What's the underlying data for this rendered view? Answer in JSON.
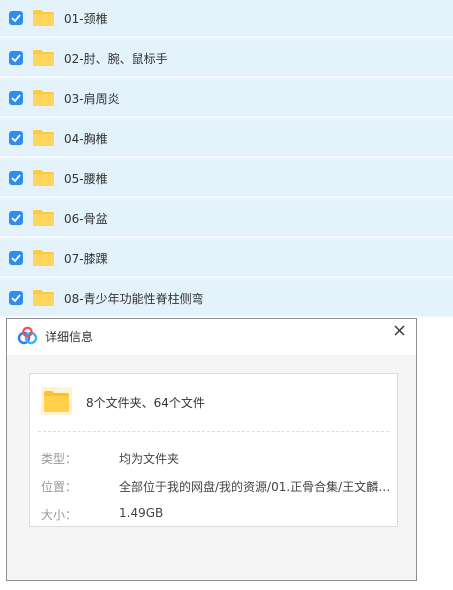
{
  "file_list": {
    "items": [
      {
        "label": "01-颈椎",
        "checked": true
      },
      {
        "label": "02-肘、腕、鼠标手",
        "checked": true
      },
      {
        "label": "03-肩周炎",
        "checked": true
      },
      {
        "label": "04-胸椎",
        "checked": true
      },
      {
        "label": "05-腰椎",
        "checked": true
      },
      {
        "label": "06-骨盆",
        "checked": true
      },
      {
        "label": "07-膝踝",
        "checked": true
      },
      {
        "label": "08-青少年功能性脊柱侧弯",
        "checked": true
      }
    ]
  },
  "dialog": {
    "title": "详细信息",
    "summary": "8个文件夹、64个文件",
    "properties": [
      {
        "label": "类型：",
        "value": "均为文件夹"
      },
      {
        "label": "位置：",
        "value": "全部位于我的网盘/我的资源/01.正骨合集/王文麟…"
      },
      {
        "label": "大小：",
        "value": "1.49GB"
      }
    ]
  },
  "icons": {
    "checkbox": "checkbox-checked-icon",
    "folder": "folder-icon",
    "brand": "baidu-netdisk-logo-icon",
    "close": "close-icon"
  },
  "colors": {
    "row_bg": "#e4f2fc",
    "checkbox": "#2d8cf0",
    "folder": "#ffc93c",
    "dialog_body": "#f5f5f5"
  }
}
